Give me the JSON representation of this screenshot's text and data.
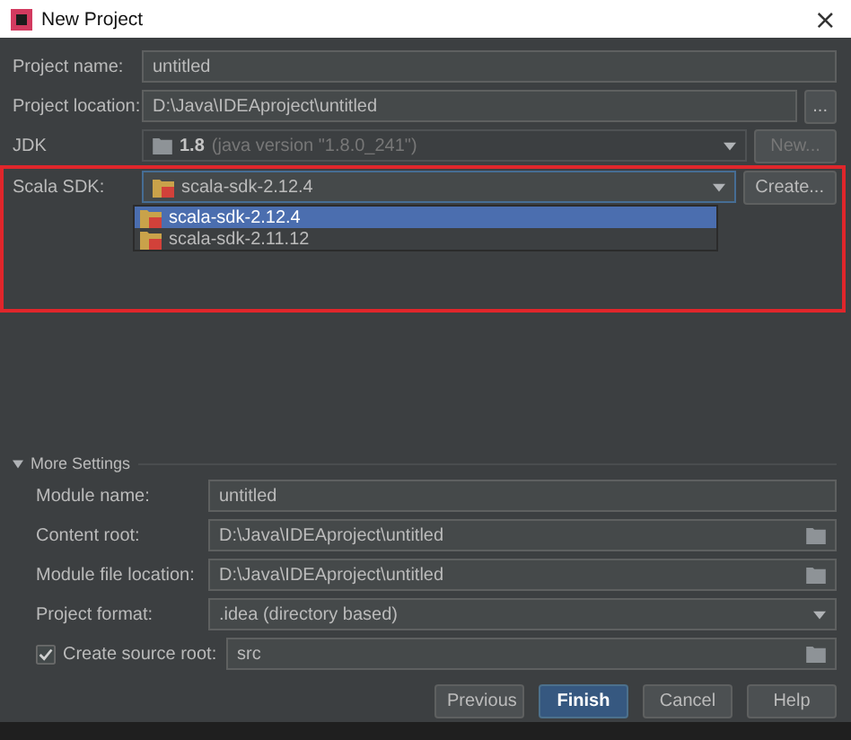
{
  "window": {
    "title": "New Project",
    "close": "×"
  },
  "fields": [
    {
      "kind": "text",
      "label": "Project name:",
      "value": "untitled"
    },
    {
      "kind": "browse",
      "label": "Project location:",
      "value": "D:\\Java\\IDEAproject\\untitled",
      "button": "..."
    }
  ],
  "jdk": {
    "label": "JDK",
    "version": "1.8",
    "detail": "(java version \"1.8.0_241\")",
    "disabled": true,
    "button": "New..."
  },
  "scala_sdk": {
    "label": "Scala SDK:",
    "value": "scala-sdk-2.12.4",
    "button": "Create...",
    "highlighted": true,
    "options": [
      {
        "label": "scala-sdk-2.12.4",
        "selected": true
      },
      {
        "label": "scala-sdk-2.11.12",
        "selected": false
      }
    ]
  },
  "more_settings": {
    "title": "More Settings",
    "expanded": true,
    "fields": [
      {
        "kind": "text",
        "label": "Module name:",
        "value": "untitled"
      },
      {
        "kind": "folder",
        "label": "Content root:",
        "value": "D:\\Java\\IDEAproject\\untitled"
      },
      {
        "kind": "folder",
        "label": "Module file location:",
        "value": "D:\\Java\\IDEAproject\\untitled"
      },
      {
        "kind": "select",
        "label": "Project format:",
        "value": ".idea (directory based)"
      },
      {
        "kind": "check",
        "label": "Create source root:",
        "checked": true,
        "value": "src"
      }
    ]
  },
  "buttons": [
    {
      "label": "Previous",
      "primary": false
    },
    {
      "label": "Finish",
      "primary": true
    },
    {
      "label": "Cancel",
      "primary": false
    },
    {
      "label": "Help",
      "primary": false
    }
  ]
}
